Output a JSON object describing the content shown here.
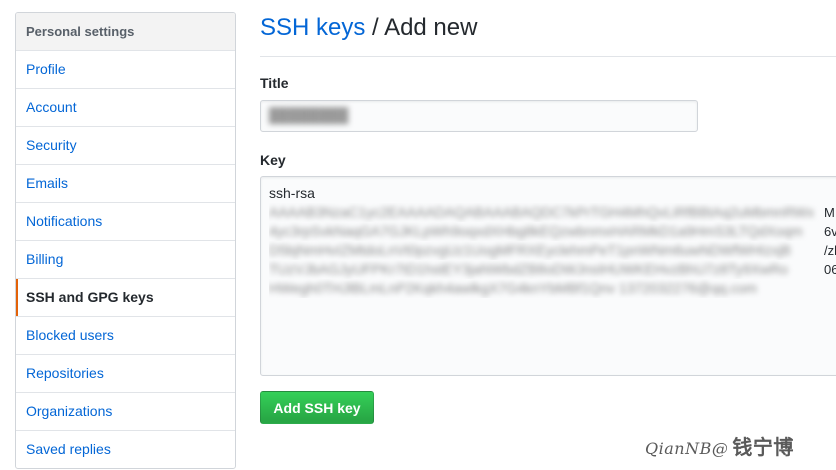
{
  "sidebar": {
    "header": "Personal settings",
    "items": [
      {
        "label": "Profile",
        "selected": false
      },
      {
        "label": "Account",
        "selected": false
      },
      {
        "label": "Security",
        "selected": false
      },
      {
        "label": "Emails",
        "selected": false
      },
      {
        "label": "Notifications",
        "selected": false
      },
      {
        "label": "Billing",
        "selected": false
      },
      {
        "label": "SSH and GPG keys",
        "selected": true
      },
      {
        "label": "Blocked users",
        "selected": false
      },
      {
        "label": "Repositories",
        "selected": false
      },
      {
        "label": "Organizations",
        "selected": false
      },
      {
        "label": "Saved replies",
        "selected": false
      }
    ]
  },
  "page": {
    "breadcrumb_link": "SSH keys",
    "separator": " / ",
    "title": "Add new"
  },
  "form": {
    "title_label": "Title",
    "title_value": "████████",
    "key_label": "Key",
    "key_first_line": "ssh-rsa",
    "key_tail": [
      "M",
      "6v",
      "/zl",
      "06"
    ],
    "submit_label": "Add SSH key"
  },
  "watermark": {
    "latin": "QianNB@",
    "chinese": "钱宁博"
  },
  "colors": {
    "link": "#0366d6",
    "selected_marker": "#e36209",
    "button_green": "#28a745"
  }
}
